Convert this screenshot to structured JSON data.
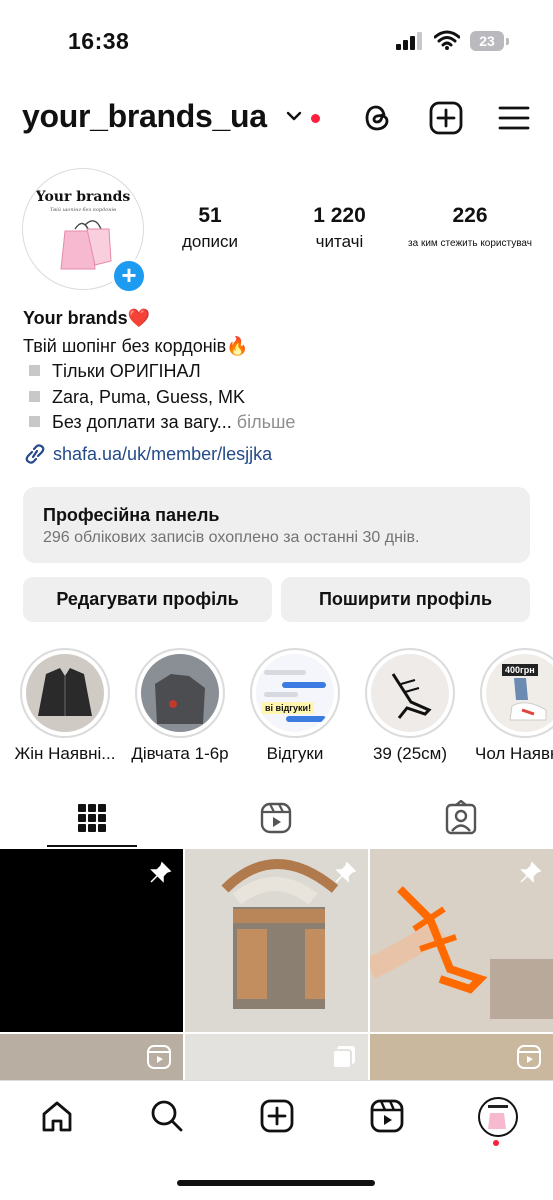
{
  "status_bar": {
    "time": "16:38",
    "battery": "23"
  },
  "header": {
    "username": "your_brands_ua"
  },
  "profile": {
    "avatar_title": "Your brands",
    "avatar_subtitle": "Твій шопінг без кордонів",
    "stats": [
      {
        "value": "51",
        "label": "дописи"
      },
      {
        "value": "1 220",
        "label": "читачі"
      },
      {
        "value": "226",
        "label": "за ким стежить користувач"
      }
    ],
    "name": "Your brands❤️",
    "bio_line1": "Твій шопінг без кордонів🔥",
    "bio_items": [
      "Тільки ОРИГІНАЛ",
      "Zara, Puma, Guess, MK",
      "Без доплати за вагу..."
    ],
    "more": "більше",
    "link": "shafa.ua/uk/member/lesjjka"
  },
  "pro_panel": {
    "title": "Професійна панель",
    "subtitle": "296 облікових записів охоплено за останні 30 днів."
  },
  "buttons": {
    "edit": "Редагувати профіль",
    "share": "Поширити профіль"
  },
  "highlights": [
    {
      "label": "Жін Наявні..."
    },
    {
      "label": "Дівчата 1-6р"
    },
    {
      "label": "Відгуки"
    },
    {
      "label": "39 (25см)"
    },
    {
      "label": "Чол Наявн"
    }
  ],
  "highlight_texts": {
    "reviews_badge": "ві відгуки!",
    "price_tag": "400грн"
  },
  "tabs": [
    "grid",
    "reels",
    "tagged"
  ],
  "colors": {
    "accent": "#1d9bf0",
    "notification": "#ff1e3c",
    "panel_bg": "#efefef"
  }
}
